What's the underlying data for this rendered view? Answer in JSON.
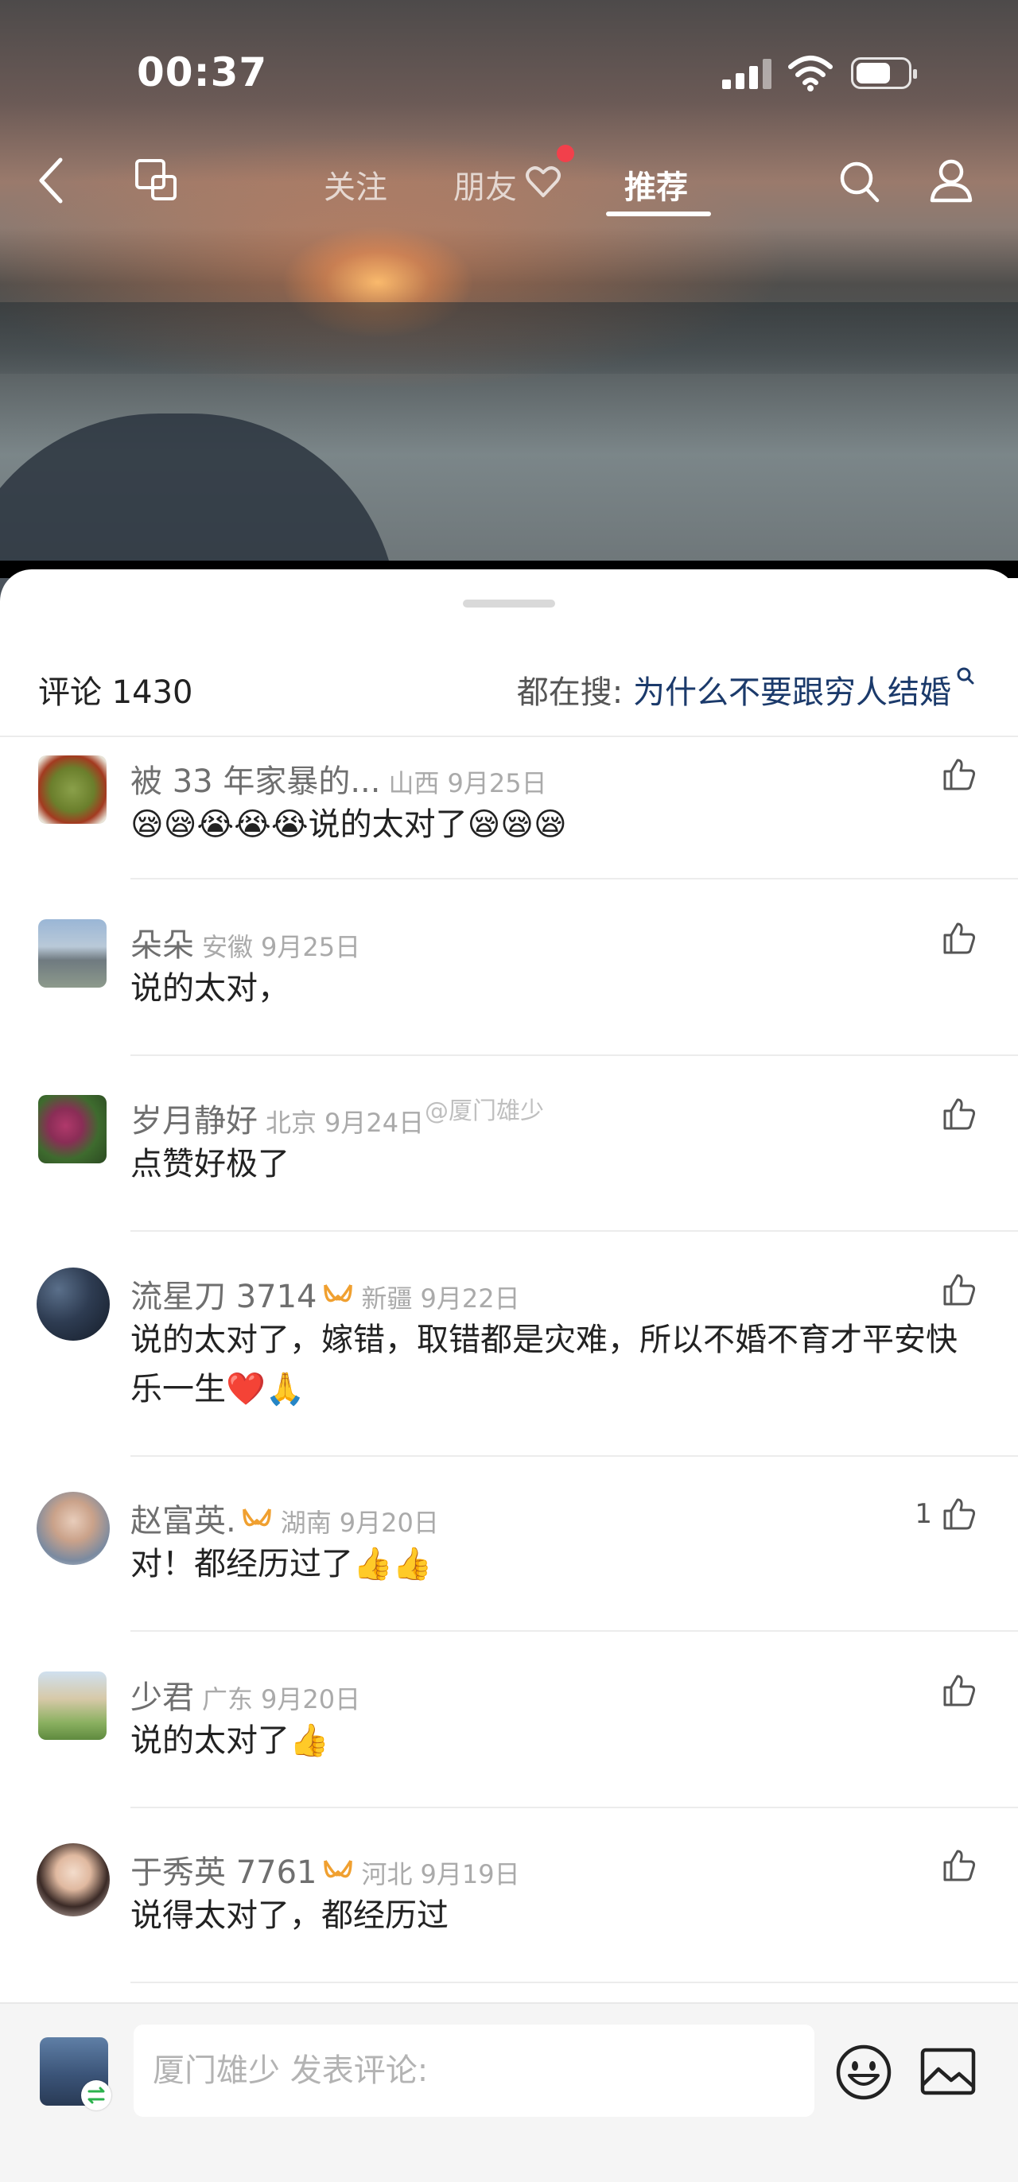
{
  "status_bar": {
    "time": "00:37"
  },
  "top_nav": {
    "tabs": [
      {
        "label": "关注",
        "active": false
      },
      {
        "label": "朋友",
        "active": false,
        "has_notification_dot": true
      },
      {
        "label": "推荐",
        "active": true
      }
    ]
  },
  "comments_header": {
    "count_label": "评论 1430",
    "hot_search_prefix": "都在搜: ",
    "hot_search_query": "为什么不要跟穷人结婚"
  },
  "comments": [
    {
      "name": "被 33 年家暴的...",
      "region": "山西",
      "date": "9月25日",
      "text": "😪😪😭😭😭说的太对了😪😪😪",
      "likes": ""
    },
    {
      "name": "朵朵",
      "region": "安徽",
      "date": "9月25日",
      "text": "说的太对，",
      "likes": ""
    },
    {
      "name": "岁月静好",
      "region": "北京",
      "date": "9月24日",
      "text": "点赞好极了",
      "likes": ""
    },
    {
      "name": "流星刀 3714",
      "region": "新疆",
      "date": "9月22日",
      "text": "说的太对了，嫁错，取错都是灾难，所以不婚不育才平安快乐一生❤️🙏",
      "likes": "",
      "badge": true
    },
    {
      "name": "赵富英.",
      "region": "湖南",
      "date": "9月20日",
      "text": "对！都经历过了👍👍",
      "likes": "1",
      "badge": true
    },
    {
      "name": "少君",
      "region": "广东",
      "date": "9月20日",
      "text": "说的太对了👍",
      "likes": ""
    },
    {
      "name": "于秀英 7761",
      "region": "河北",
      "date": "9月19日",
      "text": "说得太对了，都经历过",
      "likes": "",
      "badge": true
    }
  ],
  "watermark": "@厦门雄少",
  "bottom_bar": {
    "input_placeholder": "厦门雄少 发表评论:"
  },
  "colors": {
    "active_tab": "#ffffff",
    "notification_dot": "#f2404b",
    "hot_search_query": "#1b3a6b",
    "badge": "#f0a030"
  },
  "icons": [
    "back-icon",
    "multi-window-icon",
    "heart-icon",
    "search-icon",
    "user-icon",
    "magnifier-icon",
    "thumbs-up-icon",
    "vip-badge-icon",
    "emoji-icon",
    "image-icon",
    "switch-icon"
  ]
}
